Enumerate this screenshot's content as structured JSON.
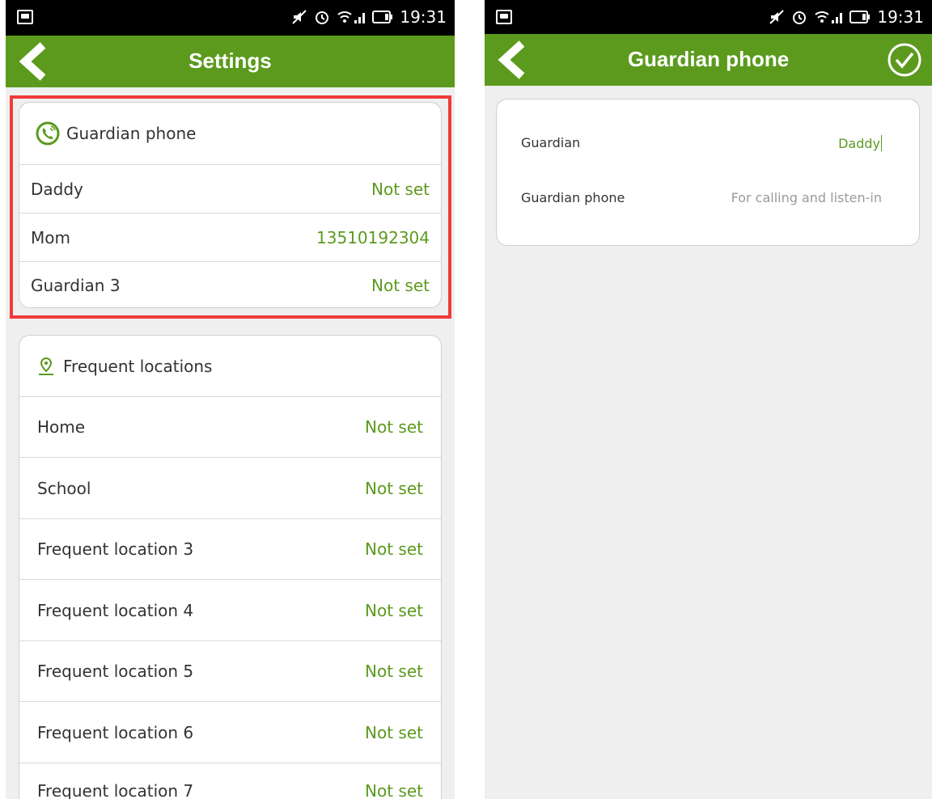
{
  "status_bar": {
    "time": "19:31"
  },
  "settings": {
    "title": "Settings",
    "guardian_card": {
      "header": "Guardian phone",
      "rows": [
        {
          "label": "Daddy",
          "value": "Not set"
        },
        {
          "label": "Mom",
          "value": "13510192304"
        },
        {
          "label": "Guardian 3",
          "value": "Not set"
        }
      ]
    },
    "locations_card": {
      "header": "Frequent locations",
      "rows": [
        {
          "label": "Home",
          "value": "Not set"
        },
        {
          "label": "School",
          "value": "Not set"
        },
        {
          "label": "Frequent location 3",
          "value": "Not set"
        },
        {
          "label": "Frequent location 4",
          "value": "Not set"
        },
        {
          "label": "Frequent location 5",
          "value": "Not set"
        },
        {
          "label": "Frequent location 6",
          "value": "Not set"
        },
        {
          "label": "Frequent location 7",
          "value": "Not set"
        }
      ]
    }
  },
  "guardian_phone": {
    "title": "Guardian phone",
    "guardian_label": "Guardian",
    "guardian_value": "Daddy",
    "phone_label": "Guardian phone",
    "phone_placeholder": "For calling and listen-in"
  },
  "colors": {
    "accent": "#5b9a1d",
    "highlight": "#ef3b3b",
    "background": "#efefef"
  }
}
